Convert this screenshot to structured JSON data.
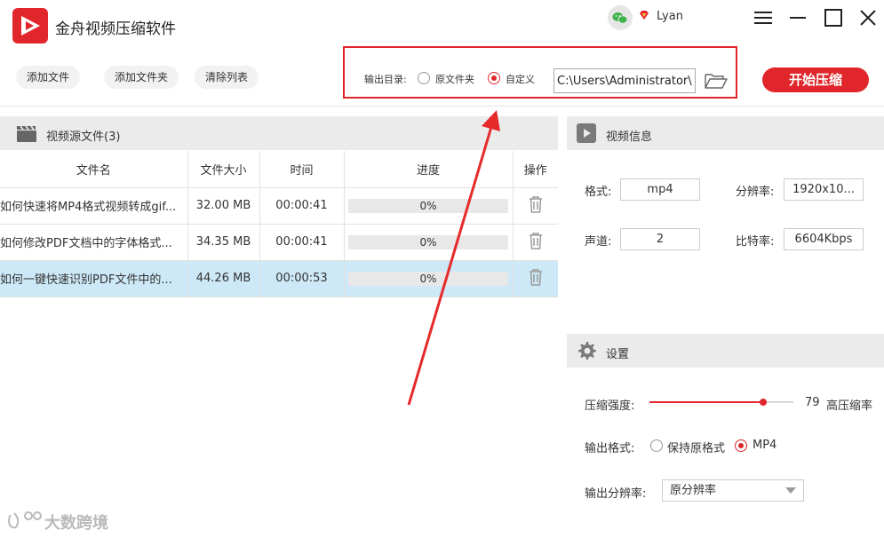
{
  "app": {
    "title": "金舟视频压缩软件",
    "user": "Lyan",
    "colors": {
      "accent": "#e0262b",
      "selected_row": "#cde8f7",
      "header_bg": "#ebebeb"
    },
    "icons": [
      "app-logo-icon",
      "wechat-icon",
      "vip-diamond-icon",
      "menu-icon",
      "minimize-icon",
      "maximize-icon",
      "close-icon"
    ]
  },
  "toolbar": {
    "add_file": "添加文件",
    "add_folder": "添加文件夹",
    "clear_list": "清除列表",
    "output_label": "输出目录:",
    "option_original": "原文件夹",
    "option_custom": "自定义",
    "selected_option": "自定义",
    "output_path": "C:\\Users\\Administrator\\",
    "start": "开始压缩"
  },
  "source": {
    "title": "视频源文件(3)",
    "columns": [
      "文件名",
      "文件大小",
      "时间",
      "进度",
      "操作"
    ],
    "rows": [
      {
        "name": "如何快速将MP4格式视频转成gif...",
        "size": "32.00 MB",
        "time": "00:00:41",
        "progress": 0,
        "progress_text": "0%",
        "selected": false
      },
      {
        "name": "如何修改PDF文档中的字体格式...",
        "size": "34.35 MB",
        "time": "00:00:41",
        "progress": 0,
        "progress_text": "0%",
        "selected": false
      },
      {
        "name": "如何一键快速识别PDF文件中的...",
        "size": "44.26 MB",
        "time": "00:00:53",
        "progress": 0,
        "progress_text": "0%",
        "selected": true
      }
    ]
  },
  "video_info": {
    "title": "视频信息",
    "format_label": "格式:",
    "format": "mp4",
    "resolution_label": "分辨率:",
    "resolution": "1920x10...",
    "channels_label": "声道:",
    "channels": "2",
    "bitrate_label": "比特率:",
    "bitrate": "6604Kbps"
  },
  "settings": {
    "title": "设置",
    "strength_label": "压缩强度:",
    "strength_value": 79,
    "strength_value_text": "79",
    "strength_max": 100,
    "strength_desc": "高压缩率",
    "format_label": "输出格式:",
    "format_keep": "保持原格式",
    "format_mp4": "MP4",
    "selected_format": "MP4",
    "resolution_label": "输出分辨率:",
    "resolution_value": "原分辨率"
  },
  "watermark": "大数跨境"
}
